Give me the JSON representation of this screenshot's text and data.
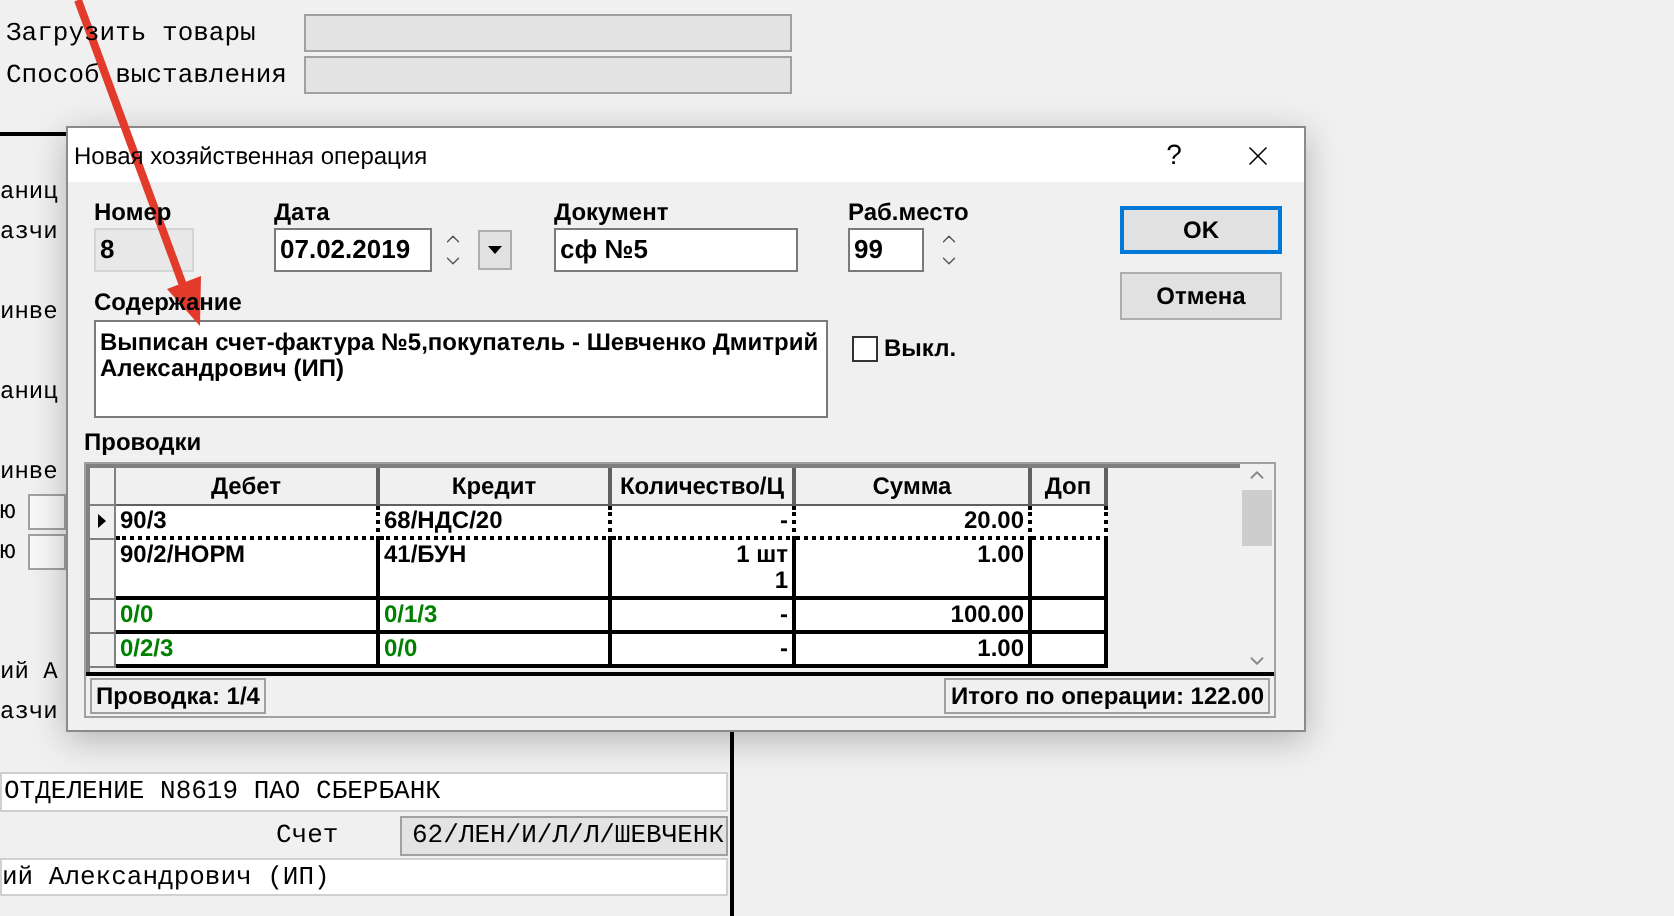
{
  "background": {
    "form_rows": [
      {
        "label": "Загрузить товары"
      },
      {
        "label": "Способ выставления"
      }
    ],
    "side_fragments": [
      {
        "kind": "text",
        "text": "аниц"
      },
      {
        "kind": "text",
        "text": "азчи"
      },
      {
        "kind": "gap"
      },
      {
        "kind": "text",
        "text": "инве"
      },
      {
        "kind": "gap"
      },
      {
        "kind": "text",
        "text": "аниц"
      },
      {
        "kind": "gap"
      },
      {
        "kind": "text",
        "text": "инве"
      },
      {
        "kind": "field",
        "text": "ю"
      },
      {
        "kind": "field",
        "text": "ю"
      },
      {
        "kind": "gap"
      },
      {
        "kind": "gap"
      },
      {
        "kind": "text",
        "text": "ий А"
      },
      {
        "kind": "text",
        "text": "азчи"
      }
    ],
    "bank": "ОТДЕЛЕНИЕ N8619 ПАО СБЕРБАНК",
    "account": {
      "label": "Счет",
      "value": "62/ЛЕН/И/Л/Л/ШЕВЧЕНК"
    },
    "name": "ий Александрович (ИП)"
  },
  "dialog": {
    "title": "Новая хозяйственная операция",
    "help": "?",
    "number": {
      "label": "Номер",
      "value": "8",
      "disabled": true
    },
    "date": {
      "label": "Дата",
      "value": "07.02.2019"
    },
    "document": {
      "label": "Документ",
      "value": "сф №5"
    },
    "workplace": {
      "label": "Раб.место",
      "value": "99"
    },
    "content": {
      "label": "Содержание",
      "value": "Выписан счет-фактура №5,покупатель - Шевченко Дмитрий Александрович (ИП)"
    },
    "checkbox": {
      "label": "Выкл.",
      "checked": false
    },
    "buttons": [
      {
        "label": "OK",
        "default": true
      },
      {
        "label": "Отмена",
        "default": false
      }
    ],
    "entries_label": "Проводки",
    "table": {
      "columns": [
        "Дебет",
        "Кредит",
        "Количество/Ц",
        "Сумма",
        "Доп"
      ],
      "rows": [
        {
          "debit": "90/3",
          "credit": "68/НДС/20",
          "quantity": [
            "-"
          ],
          "sum": "20.00",
          "selected": true,
          "color": "#000000"
        },
        {
          "debit": "90/2/НОРМ",
          "credit": "41/БУН",
          "quantity": [
            "1 шт",
            "1"
          ],
          "sum": "1.00",
          "selected": false,
          "color": "#000000"
        },
        {
          "debit": "0/0",
          "credit": "0/1/3",
          "quantity": [
            "-"
          ],
          "sum": "100.00",
          "selected": false,
          "color": "#008000"
        },
        {
          "debit": "0/2/3",
          "credit": "0/0",
          "quantity": [
            "-"
          ],
          "sum": "1.00",
          "selected": false,
          "color": "#008000"
        }
      ]
    },
    "status": {
      "position": "Проводка: 1/4",
      "total": "Итого по операции: 122.00"
    }
  }
}
